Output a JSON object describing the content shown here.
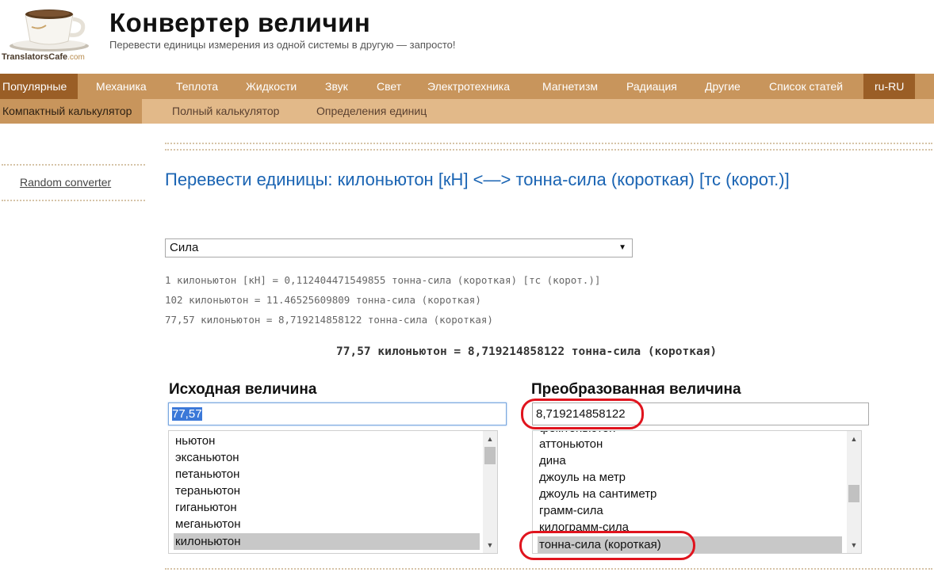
{
  "header": {
    "logo_text": "TranslatorsCafe",
    "logo_suffix": ".com",
    "title": "Конвертер величин",
    "subtitle": "Перевести единицы измерения из одной системы в другую — запросто!"
  },
  "main_nav": [
    {
      "label": "Популярные",
      "active": true
    },
    {
      "label": "Механика"
    },
    {
      "label": "Теплота"
    },
    {
      "label": "Жидкости"
    },
    {
      "label": "Звук"
    },
    {
      "label": "Свет"
    },
    {
      "label": "Электротехника"
    },
    {
      "label": "Магнетизм"
    },
    {
      "label": "Радиация"
    },
    {
      "label": "Другие"
    },
    {
      "label": "Список статей"
    },
    {
      "label": "ru-RU"
    }
  ],
  "sub_nav": [
    {
      "label": "Компактный калькулятор",
      "active": true
    },
    {
      "label": "Полный калькулятор"
    },
    {
      "label": "Определения единиц"
    }
  ],
  "sidebar": {
    "random_link": "Random converter"
  },
  "heading": "Перевести единицы: килоньютон [кН] <—> тонна-сила (короткая) [тс (корот.)]",
  "category_select": {
    "value": "Сила"
  },
  "results": [
    "1 килоньютон [кН] = 0,112404471549855 тонна-сила (короткая) [тс (корот.)]",
    "102 килоньютон = 11.46525609809 тонна-сила (короткая)",
    "77,57 килоньютон = 8,719214858122 тонна-сила (короткая)"
  ],
  "main_result": "77,57 килоньютон = 8,719214858122 тонна-сила (короткая)",
  "from": {
    "title": "Исходная величина",
    "value": "77,57",
    "options": [
      "ньютон",
      "эксаньютон",
      "петаньютон",
      "тераньютон",
      "гиганьютон",
      "меганьютон",
      "килоньютон"
    ],
    "selected": "килоньютон"
  },
  "to": {
    "title": "Преобразованная величина",
    "value": "8,719214858122",
    "options": [
      "фемтоньютон",
      "аттоньютон",
      "дина",
      "джоуль на метр",
      "джоуль на сантиметр",
      "грамм-сила",
      "килограмм-сила",
      "тонна-сила (короткая)"
    ],
    "selected": "тонна-сила (короткая)"
  },
  "colors": {
    "nav_bg": "#c8955c",
    "nav_active": "#9a5e26",
    "subnav_bg": "#e2b989",
    "heading": "#1a64b3",
    "highlight_oval": "#e0141e"
  }
}
